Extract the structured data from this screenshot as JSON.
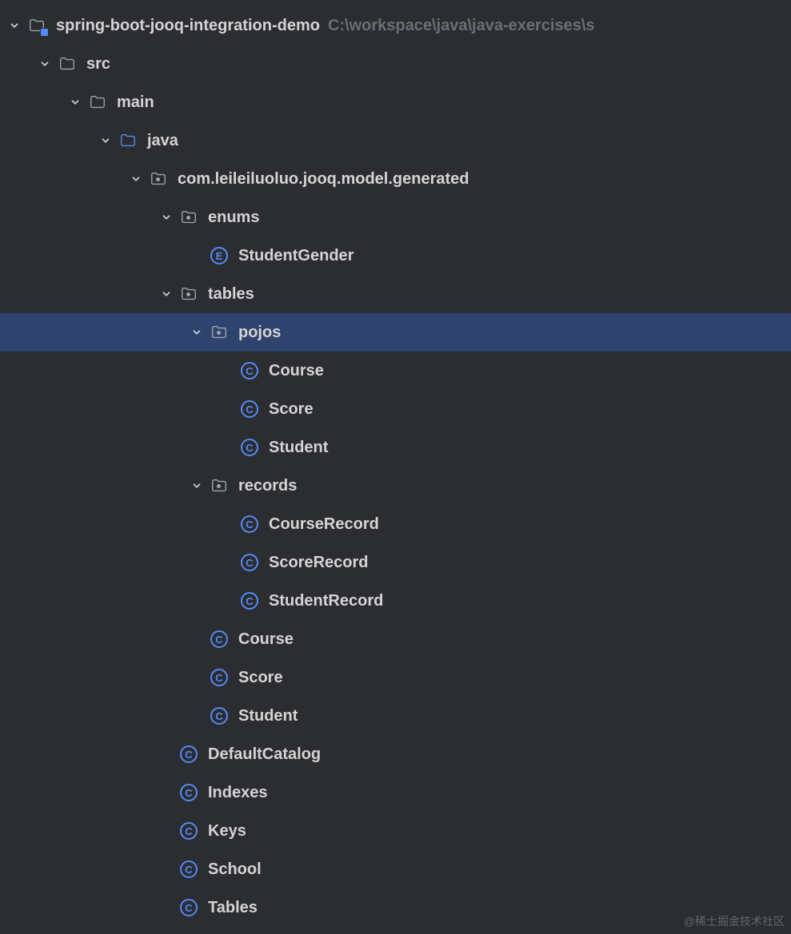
{
  "watermark": "@稀土掘金技术社区",
  "tree": [
    {
      "level": 0,
      "chevron": "down",
      "iconType": "module",
      "name": "project-root",
      "label": "spring-boot-jooq-integration-demo",
      "path": "C:\\workspace\\java\\java-exercises\\s",
      "selected": false
    },
    {
      "level": 1,
      "chevron": "down",
      "iconType": "folder",
      "name": "folder-src",
      "label": "src",
      "selected": false
    },
    {
      "level": 2,
      "chevron": "down",
      "iconType": "folder",
      "name": "folder-main",
      "label": "main",
      "selected": false
    },
    {
      "level": 3,
      "chevron": "down",
      "iconType": "folder-blue",
      "name": "folder-java",
      "label": "java",
      "selected": false
    },
    {
      "level": 4,
      "chevron": "down",
      "iconType": "package",
      "name": "package-generated",
      "label": "com.leileiluoluo.jooq.model.generated",
      "selected": false
    },
    {
      "level": 5,
      "chevron": "down",
      "iconType": "package",
      "name": "package-enums",
      "label": "enums",
      "selected": false
    },
    {
      "level": 6,
      "chevron": "none",
      "iconType": "enum",
      "name": "enum-studentgender",
      "label": "StudentGender",
      "selected": false
    },
    {
      "level": 5,
      "chevron": "down",
      "iconType": "package",
      "name": "package-tables",
      "label": "tables",
      "selected": false
    },
    {
      "level": 6,
      "chevron": "down",
      "iconType": "package",
      "name": "package-pojos",
      "label": "pojos",
      "selected": true
    },
    {
      "level": 7,
      "chevron": "none",
      "iconType": "class",
      "name": "class-pojo-course",
      "label": "Course",
      "selected": false
    },
    {
      "level": 7,
      "chevron": "none",
      "iconType": "class",
      "name": "class-pojo-score",
      "label": "Score",
      "selected": false
    },
    {
      "level": 7,
      "chevron": "none",
      "iconType": "class",
      "name": "class-pojo-student",
      "label": "Student",
      "selected": false
    },
    {
      "level": 6,
      "chevron": "down",
      "iconType": "package",
      "name": "package-records",
      "label": "records",
      "selected": false
    },
    {
      "level": 7,
      "chevron": "none",
      "iconType": "class",
      "name": "class-courserecord",
      "label": "CourseRecord",
      "selected": false
    },
    {
      "level": 7,
      "chevron": "none",
      "iconType": "class",
      "name": "class-scorerecord",
      "label": "ScoreRecord",
      "selected": false
    },
    {
      "level": 7,
      "chevron": "none",
      "iconType": "class",
      "name": "class-studentrecord",
      "label": "StudentRecord",
      "selected": false
    },
    {
      "level": 6,
      "chevron": "none",
      "iconType": "class",
      "name": "class-table-course",
      "label": "Course",
      "selected": false
    },
    {
      "level": 6,
      "chevron": "none",
      "iconType": "class",
      "name": "class-table-score",
      "label": "Score",
      "selected": false
    },
    {
      "level": 6,
      "chevron": "none",
      "iconType": "class",
      "name": "class-table-student",
      "label": "Student",
      "selected": false
    },
    {
      "level": 5,
      "chevron": "none",
      "iconType": "class",
      "name": "class-defaultcatalog",
      "label": "DefaultCatalog",
      "selected": false
    },
    {
      "level": 5,
      "chevron": "none",
      "iconType": "class",
      "name": "class-indexes",
      "label": "Indexes",
      "selected": false
    },
    {
      "level": 5,
      "chevron": "none",
      "iconType": "class",
      "name": "class-keys",
      "label": "Keys",
      "selected": false
    },
    {
      "level": 5,
      "chevron": "none",
      "iconType": "class",
      "name": "class-school",
      "label": "School",
      "selected": false
    },
    {
      "level": 5,
      "chevron": "none",
      "iconType": "class",
      "name": "class-tables",
      "label": "Tables",
      "selected": false
    }
  ]
}
